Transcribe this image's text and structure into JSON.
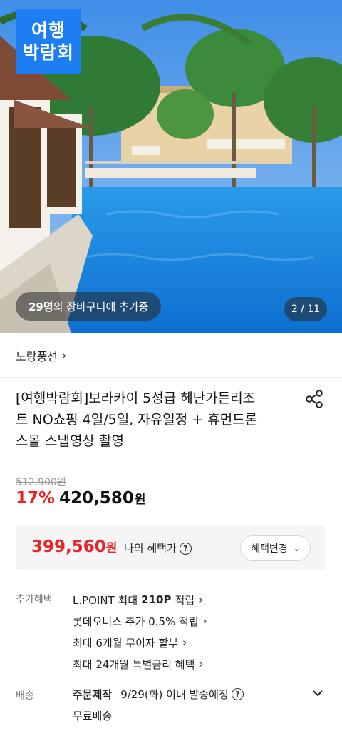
{
  "hero": {
    "brand_logo_line1": "여행",
    "brand_logo_line2": "박람회",
    "cart_count": "29명",
    "cart_text": "의 장바구니에 추가중",
    "page_indicator": "2 / 11"
  },
  "store": {
    "name": "노랑풍선",
    "chevron": "›"
  },
  "product": {
    "title_line1": "[여행박람회]보라카이 5성급 헤난가든리조",
    "title_line2": "트 NO쇼핑 4일/5일, 자유일정 + 휴먼드론",
    "title_line3": "스몰 스냅영상 촬영"
  },
  "price": {
    "original": "512,900원",
    "discount": "17%",
    "sale": "420,580",
    "sale_unit": "원",
    "benefit_price": "399,560",
    "benefit_unit": "원",
    "benefit_label": "나의 혜택가",
    "help": "?",
    "change_button": "혜택변경",
    "change_arrow": "⌄"
  },
  "extra_benefits": {
    "label": "추가혜택",
    "items": [
      {
        "text": "L.POINT 최대",
        "bold": "210P",
        "suffix": "적립",
        "arrow": "›"
      },
      {
        "text": "롯데오너스 추가 0.5% 적립",
        "arrow": "›"
      },
      {
        "text": "최대 6개월 무이자 할부",
        "arrow": "›"
      },
      {
        "text": "최대 24개월 특별금리 혜택",
        "arrow": "›"
      }
    ]
  },
  "shipping": {
    "label": "배송",
    "method": "주문제작",
    "schedule": "9/29(화) 이내 발송예정",
    "help": "?",
    "fee": "무료배송"
  },
  "colors": {
    "accent_red": "#e52528",
    "brand_blue": "#1c7ef2",
    "pool_blue": "#1684e0"
  },
  "icons": [
    "share-icon",
    "help-icon",
    "chevron-right-icon",
    "chevron-down-icon"
  ]
}
